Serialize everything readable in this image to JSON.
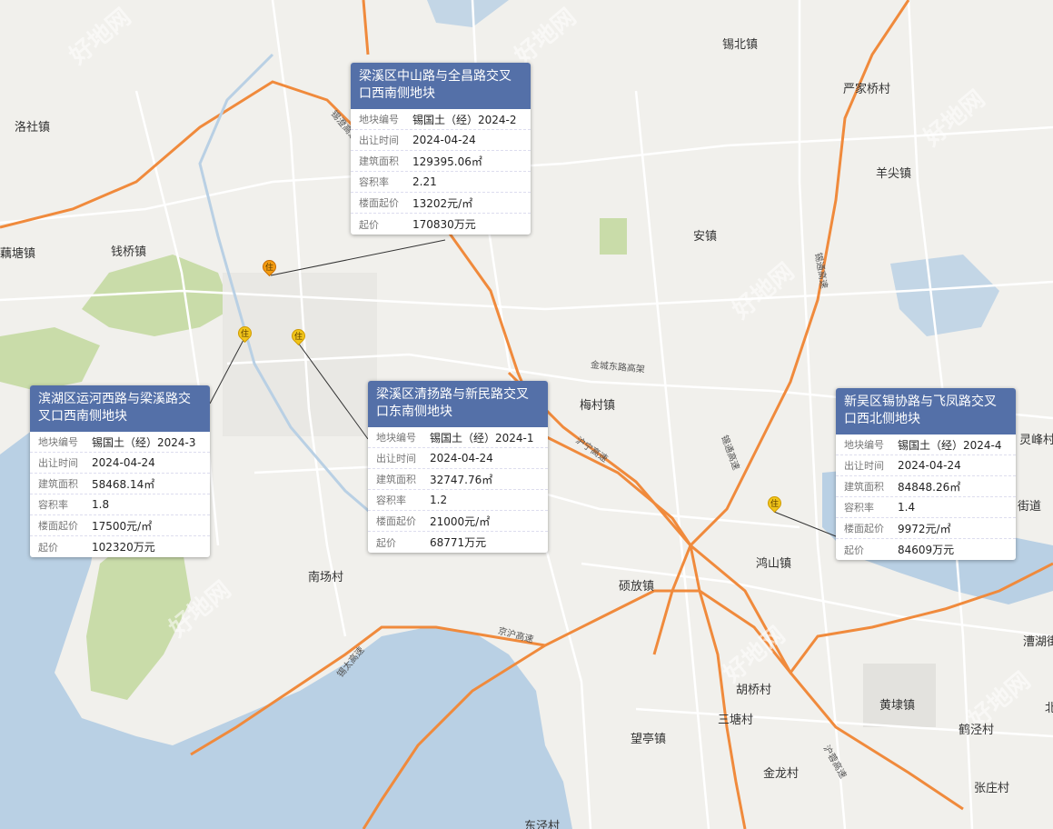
{
  "listings": [
    {
      "title": "梁溪区中山路与全昌路交叉口西南侧地块",
      "rows": [
        {
          "key": "地块编号",
          "value": "锡国土（经）2024-2"
        },
        {
          "key": "出让时间",
          "value": "2024-04-24"
        },
        {
          "key": "建筑面积",
          "value": "129395.06㎡"
        },
        {
          "key": "容积率",
          "value": "2.21"
        },
        {
          "key": "楼面起价",
          "value": "13202元/㎡"
        },
        {
          "key": "起价",
          "value": "170830万元"
        }
      ]
    },
    {
      "title": "滨湖区运河西路与梁溪路交叉口西南侧地块",
      "rows": [
        {
          "key": "地块编号",
          "value": "锡国土（经）2024-3"
        },
        {
          "key": "出让时间",
          "value": "2024-04-24"
        },
        {
          "key": "建筑面积",
          "value": "58468.14㎡"
        },
        {
          "key": "容积率",
          "value": "1.8"
        },
        {
          "key": "楼面起价",
          "value": "17500元/㎡"
        },
        {
          "key": "起价",
          "value": "102320万元"
        }
      ]
    },
    {
      "title": "梁溪区清扬路与新民路交叉口东南侧地块",
      "rows": [
        {
          "key": "地块编号",
          "value": "锡国土（经）2024-1"
        },
        {
          "key": "出让时间",
          "value": "2024-04-24"
        },
        {
          "key": "建筑面积",
          "value": "32747.76㎡"
        },
        {
          "key": "容积率",
          "value": "1.2"
        },
        {
          "key": "楼面起价",
          "value": "21000元/㎡"
        },
        {
          "key": "起价",
          "value": "68771万元"
        }
      ]
    },
    {
      "title": "新吴区锡协路与飞凤路交叉口西北侧地块",
      "rows": [
        {
          "key": "地块编号",
          "value": "锡国土（经）2024-4"
        },
        {
          "key": "出让时间",
          "value": "2024-04-24"
        },
        {
          "key": "建筑面积",
          "value": "84848.26㎡"
        },
        {
          "key": "容积率",
          "value": "1.4"
        },
        {
          "key": "楼面起价",
          "value": "9972元/㎡"
        },
        {
          "key": "起价",
          "value": "84609万元"
        }
      ]
    }
  ],
  "marker_text": "住",
  "places": [
    "锡北镇",
    "严家桥村",
    "洛社镇",
    "羊尖镇",
    "藕塘镇",
    "钱桥镇",
    "安镇",
    "梅村镇",
    "灵峰村",
    "街道",
    "鸿山镇",
    "南场村",
    "硕放镇",
    "漕湖街",
    "胡桥村",
    "黄埭镇",
    "三塘村",
    "鹤泾村",
    "望亭镇",
    "金龙村",
    "张庄村",
    "东泾村",
    "北"
  ],
  "roads": [
    "锡澄高速",
    "沪宁高速",
    "锡通高速",
    "京沪高速",
    "金城东路高架",
    "锡太高速",
    "沪蓉高速"
  ],
  "watermark": "好地网",
  "colors": {
    "card_header": "#5470a8",
    "highway": "#f08a3c",
    "water": "#b9d0e4",
    "green": "#c9dca9"
  }
}
